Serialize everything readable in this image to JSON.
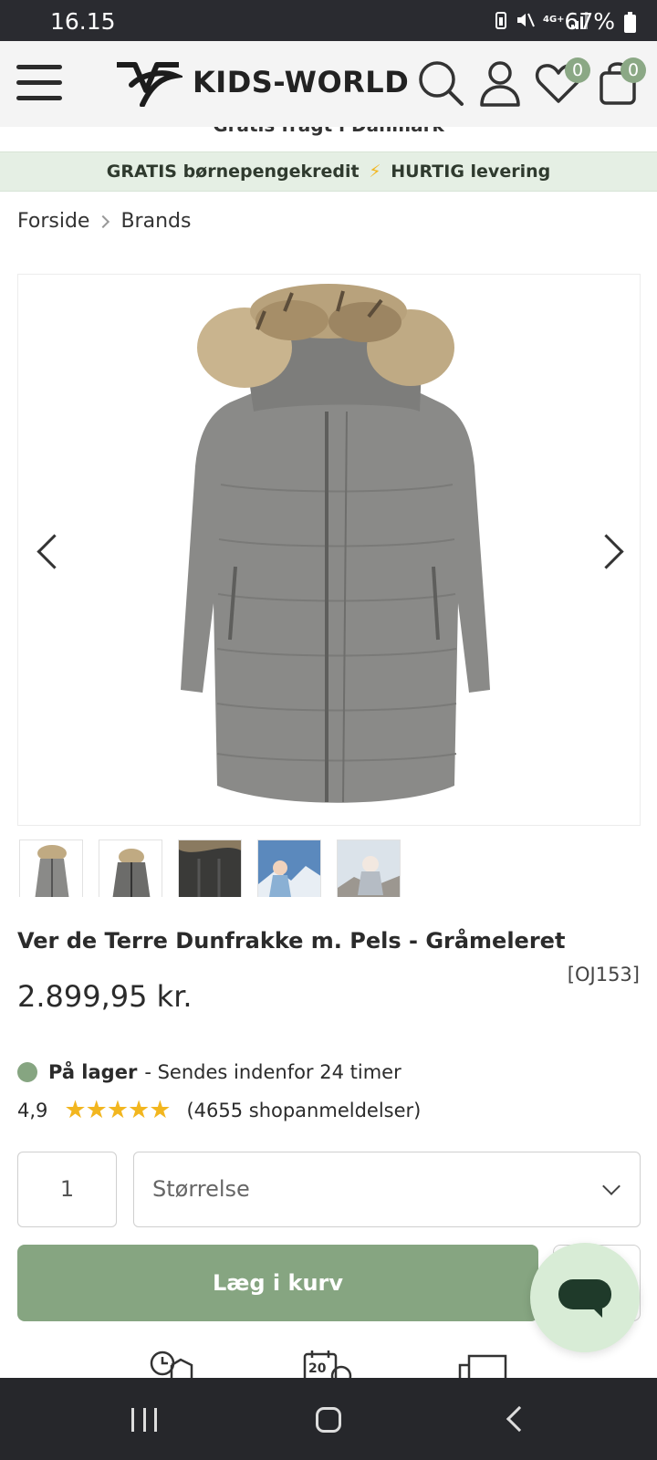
{
  "status_bar": {
    "time": "16.15",
    "network": "4G+",
    "battery": "67%"
  },
  "header": {
    "logo_text": "KIDS-WORLD",
    "wishlist_count": "0",
    "cart_count": "0"
  },
  "promo": {
    "shipping_text": "Gratis fragt i Danmark",
    "bar_left": "GRATIS børnepengekredit",
    "bar_right": "HURTIG levering"
  },
  "breadcrumb": {
    "items": [
      "Forside",
      "Brands"
    ]
  },
  "product": {
    "title": "Ver de Terre Dunfrakke m. Pels - Gråmeleret",
    "sku": "[OJ153]",
    "price": "2.899,95 kr.",
    "stock_status": "På lager",
    "stock_note": "- Sendes indenfor 24 timer",
    "rating_score": "4,9",
    "rating_stars": 5,
    "review_count": "(4655 shopanmeldelser)",
    "thumbnail_count": 5
  },
  "purchase": {
    "quantity": "1",
    "size_placeholder": "Størrelse",
    "add_to_cart_label": "Læg i kurv"
  },
  "usp": {
    "calendar_number": "20"
  },
  "colors": {
    "accent_green": "#86a581",
    "promo_bg": "#e5efe4",
    "star": "#f2b61f",
    "chat_bg": "#d8ecd6"
  }
}
